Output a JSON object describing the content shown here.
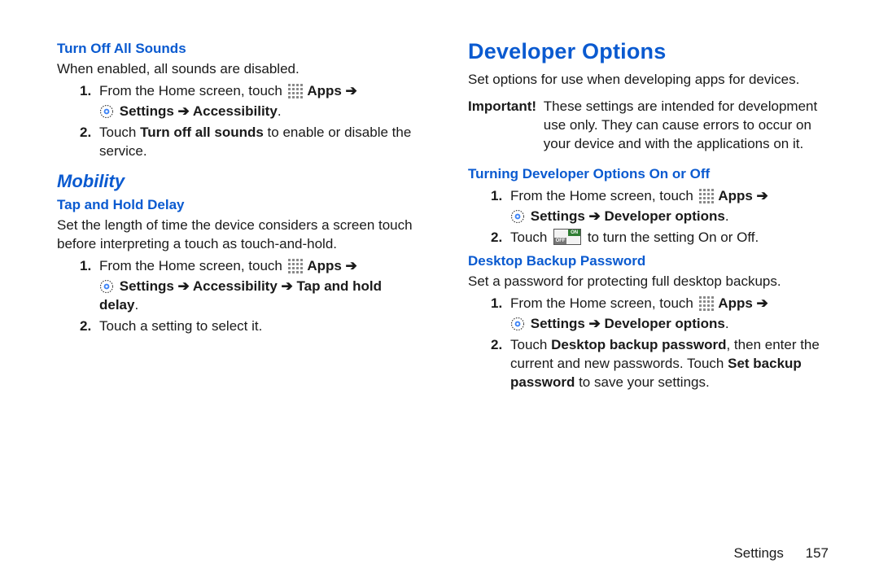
{
  "left": {
    "turn_off": {
      "title": "Turn Off All Sounds",
      "intro": "When enabled, all sounds are disabled.",
      "step1a": "From the Home screen, touch ",
      "step1b": "Apps",
      "step1c_settings": "Settings",
      "step1c_access": "Accessibility",
      "step2a": "Touch ",
      "step2b": "Turn off all sounds",
      "step2c": " to enable or disable the service."
    },
    "mobility_title": "Mobility",
    "tap_hold": {
      "title": "Tap and Hold Delay",
      "intro": "Set the length of time the device considers a screen touch before interpreting a touch as touch-and-hold.",
      "step1a": "From the Home screen, touch ",
      "step1b": "Apps",
      "step1c_settings": "Settings",
      "step1c_access": "Accessibility",
      "step1c_tap": "Tap and hold delay",
      "step2": "Touch a setting to select it."
    }
  },
  "right": {
    "dev_title": "Developer Options",
    "dev_intro": "Set options for use when developing apps for devices.",
    "important_label": "Important!",
    "important_body": "These settings are intended for development use only. They can cause errors to occur on your device and with the applications on it.",
    "turning": {
      "title": "Turning Developer Options On or Off",
      "step1a": "From the Home screen, touch ",
      "step1b": "Apps",
      "step1c_settings": "Settings",
      "step1c_dev": "Developer options",
      "step2a": "Touch ",
      "step2b": " to turn the setting On or Off."
    },
    "desktop": {
      "title": "Desktop Backup Password",
      "intro": "Set a password for protecting full desktop backups.",
      "step1a": "From the Home screen, touch ",
      "step1b": "Apps",
      "step1c_settings": "Settings",
      "step1c_dev": "Developer options",
      "step2a": "Touch ",
      "step2b": "Desktop backup password",
      "step2c": ", then enter the current and new passwords. Touch ",
      "step2d": "Set backup password",
      "step2e": " to save your settings."
    }
  },
  "footer": {
    "section": "Settings",
    "page": "157"
  },
  "arrow": " ➔ "
}
